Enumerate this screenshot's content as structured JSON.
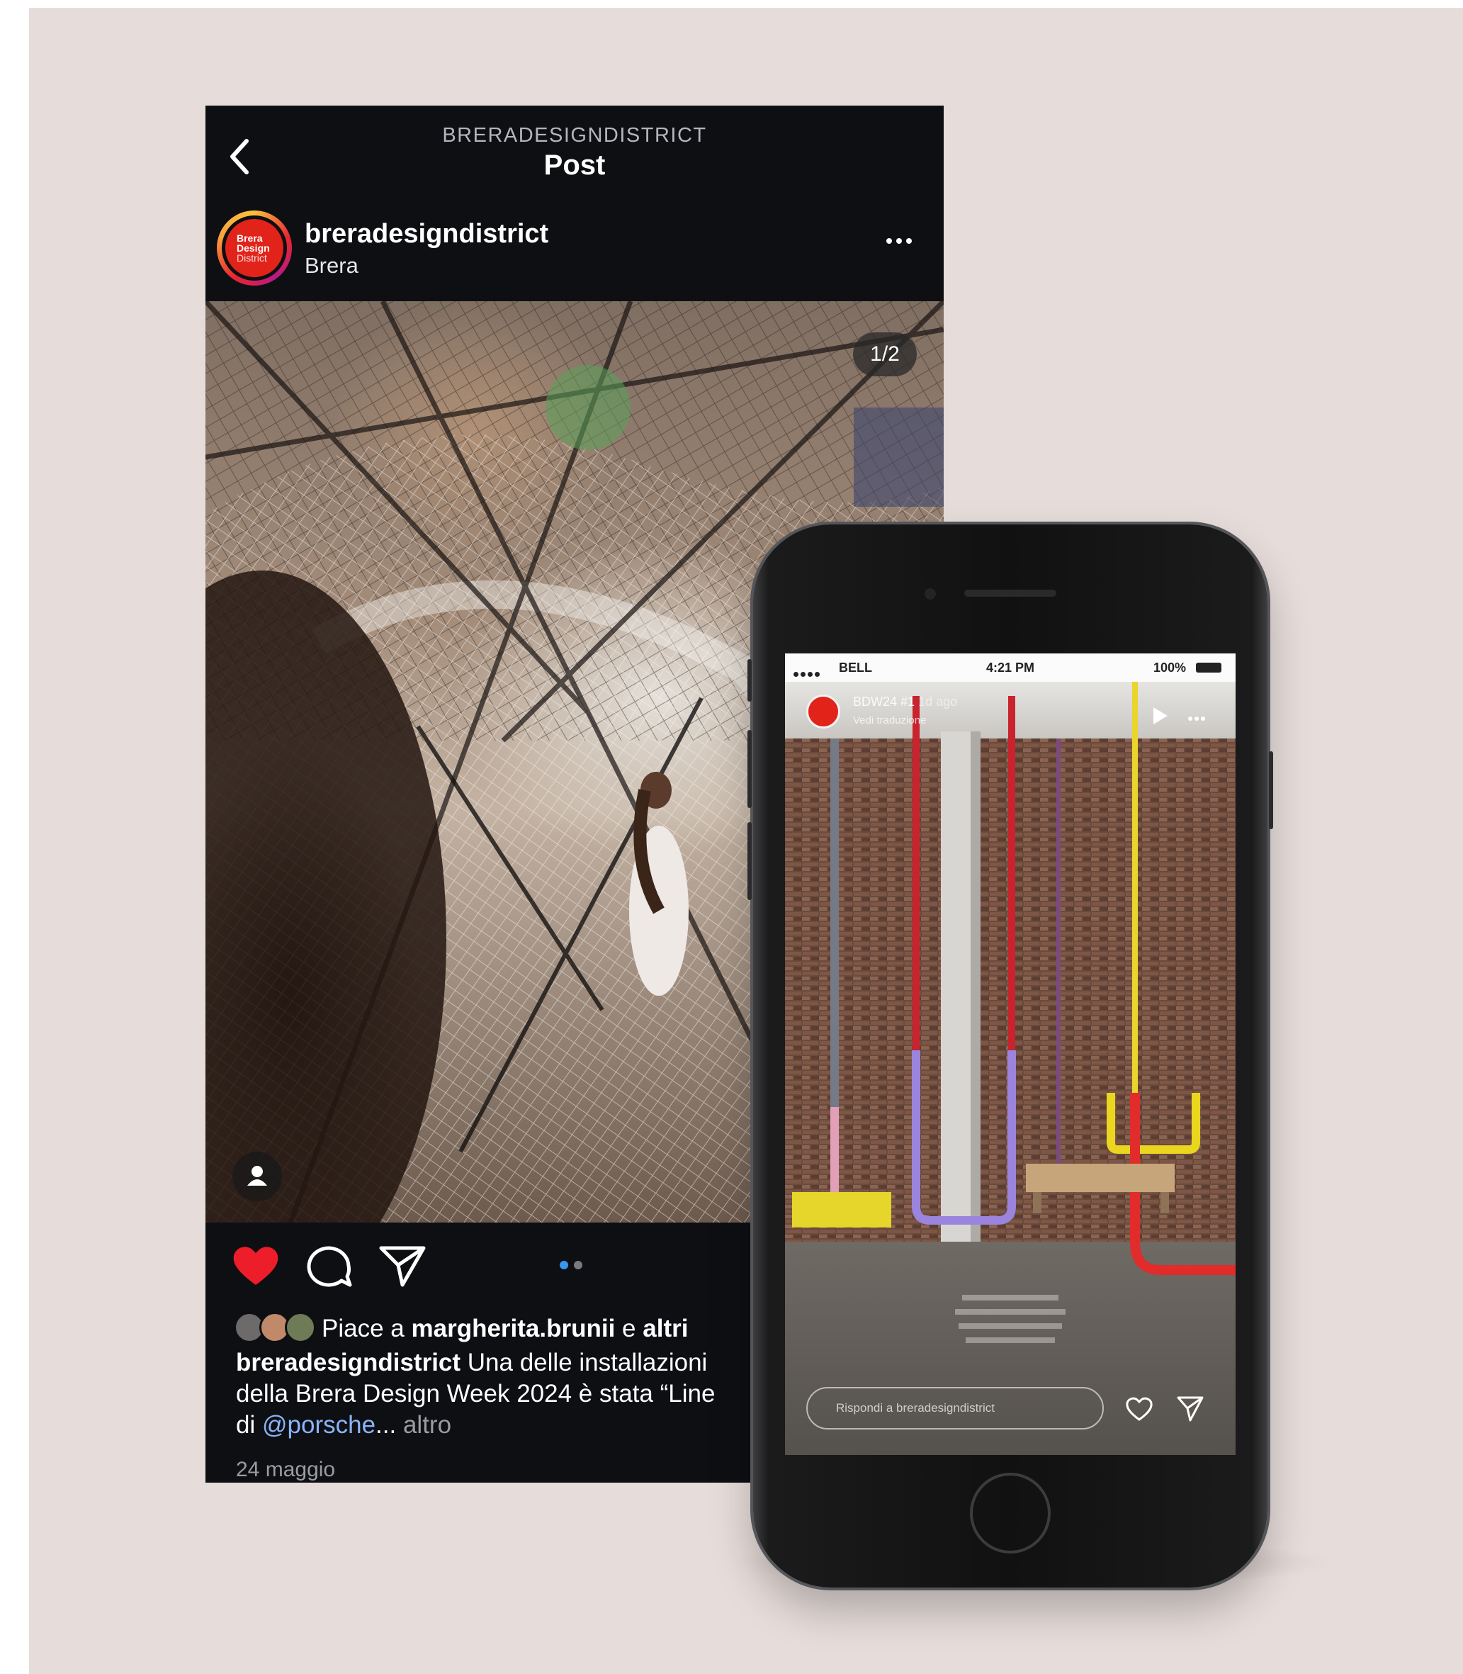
{
  "post_screen": {
    "header_owner": "BRERADESIGNDISTRICT",
    "header_title": "Post",
    "username": "breradesigndistrict",
    "location": "Brera",
    "avatar_text": [
      "Brera",
      "Design",
      "District"
    ],
    "image_counter": "1/2",
    "likes_prefix": "Piace a",
    "likes_user": "margherita.brunii",
    "likes_and": "e",
    "likes_others": "altri",
    "caption_user": "breradesigndistrict",
    "caption_line1": "Una delle installazioni",
    "caption_line2": "della Brera Design Week 2024 è stata “Line",
    "caption_di": "di",
    "caption_mention": "@porsche",
    "caption_ellipsis": "...",
    "caption_more": "altro",
    "date": "24 maggio",
    "liked_color": "#ee1d2a",
    "active_dot_color": "#3897f0"
  },
  "phone_story": {
    "status_carrier": "BELL",
    "status_time": "4:21 PM",
    "status_battery": "100%",
    "story_title": "BDW24 #1",
    "story_age": "1d ago",
    "story_subtitle": "Vedi traduzione",
    "reply_placeholder": "Rispondi a breradesigndistrict"
  },
  "icons": {
    "back": "chevron-left-icon",
    "more": "more-horizontal-icon",
    "like": "heart-filled-icon",
    "comment": "comment-bubble-icon",
    "share": "paper-plane-icon",
    "tag": "person-icon"
  }
}
